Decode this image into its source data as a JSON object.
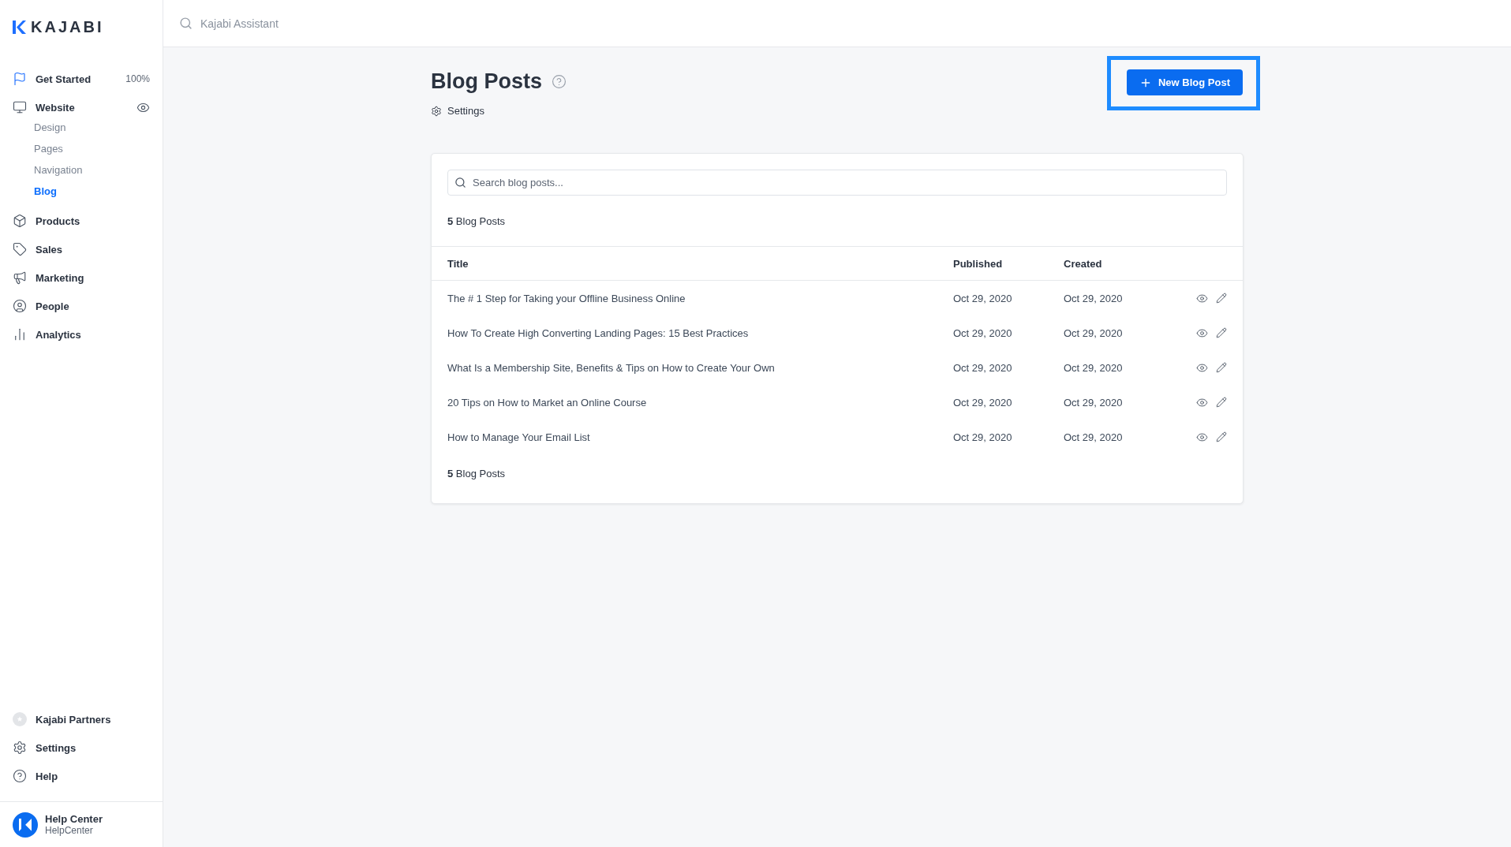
{
  "sidebar": {
    "logo": "KAJABI",
    "items": [
      {
        "label": "Get Started",
        "badge": "100%",
        "selected": false
      },
      {
        "label": "Website",
        "selected": false,
        "children": [
          {
            "label": "Design",
            "selected": false
          },
          {
            "label": "Pages",
            "selected": false
          },
          {
            "label": "Navigation",
            "selected": false
          },
          {
            "label": "Blog",
            "selected": true
          }
        ]
      },
      {
        "label": "Products",
        "selected": false
      },
      {
        "label": "Sales",
        "selected": false
      },
      {
        "label": "Marketing",
        "selected": false
      },
      {
        "label": "People",
        "selected": false
      },
      {
        "label": "Analytics",
        "selected": false
      }
    ],
    "bottom_items": [
      {
        "label": "Kajabi Partners"
      },
      {
        "label": "Settings"
      },
      {
        "label": "Help"
      }
    ],
    "account": {
      "name": "Help Center",
      "subtitle": "HelpCenter"
    }
  },
  "header": {
    "search": {
      "placeholder": "Kajabi Assistant"
    }
  },
  "page": {
    "title": "Blog Posts",
    "settings_link": "Settings",
    "new_button": "New Blog Post"
  },
  "card": {
    "search": {
      "placeholder": "Search blog posts..."
    },
    "count_top": "**5** Blog Posts",
    "count_bottom": "**5** Blog Posts",
    "table": {
      "columns": [
        "Title",
        "Published",
        "Created"
      ],
      "rows": [
        {
          "title": "The # 1 Step for Taking your Offline Business Online",
          "published": "Oct 29, 2020",
          "created": "Oct 29, 2020"
        },
        {
          "title": "How To Create High Converting Landing Pages: 15 Best Practices",
          "published": "Oct 29, 2020",
          "created": "Oct 29, 2020"
        },
        {
          "title": "What Is a Membership Site, Benefits & Tips on How to Create Your Own",
          "published": "Oct 29, 2020",
          "created": "Oct 29, 2020"
        },
        {
          "title": "20 Tips on How to Market an Online Course",
          "published": "Oct 29, 2020",
          "created": "Oct 29, 2020"
        },
        {
          "title": "How to Manage Your Email List",
          "published": "Oct 29, 2020",
          "created": "Oct 29, 2020"
        }
      ]
    }
  }
}
